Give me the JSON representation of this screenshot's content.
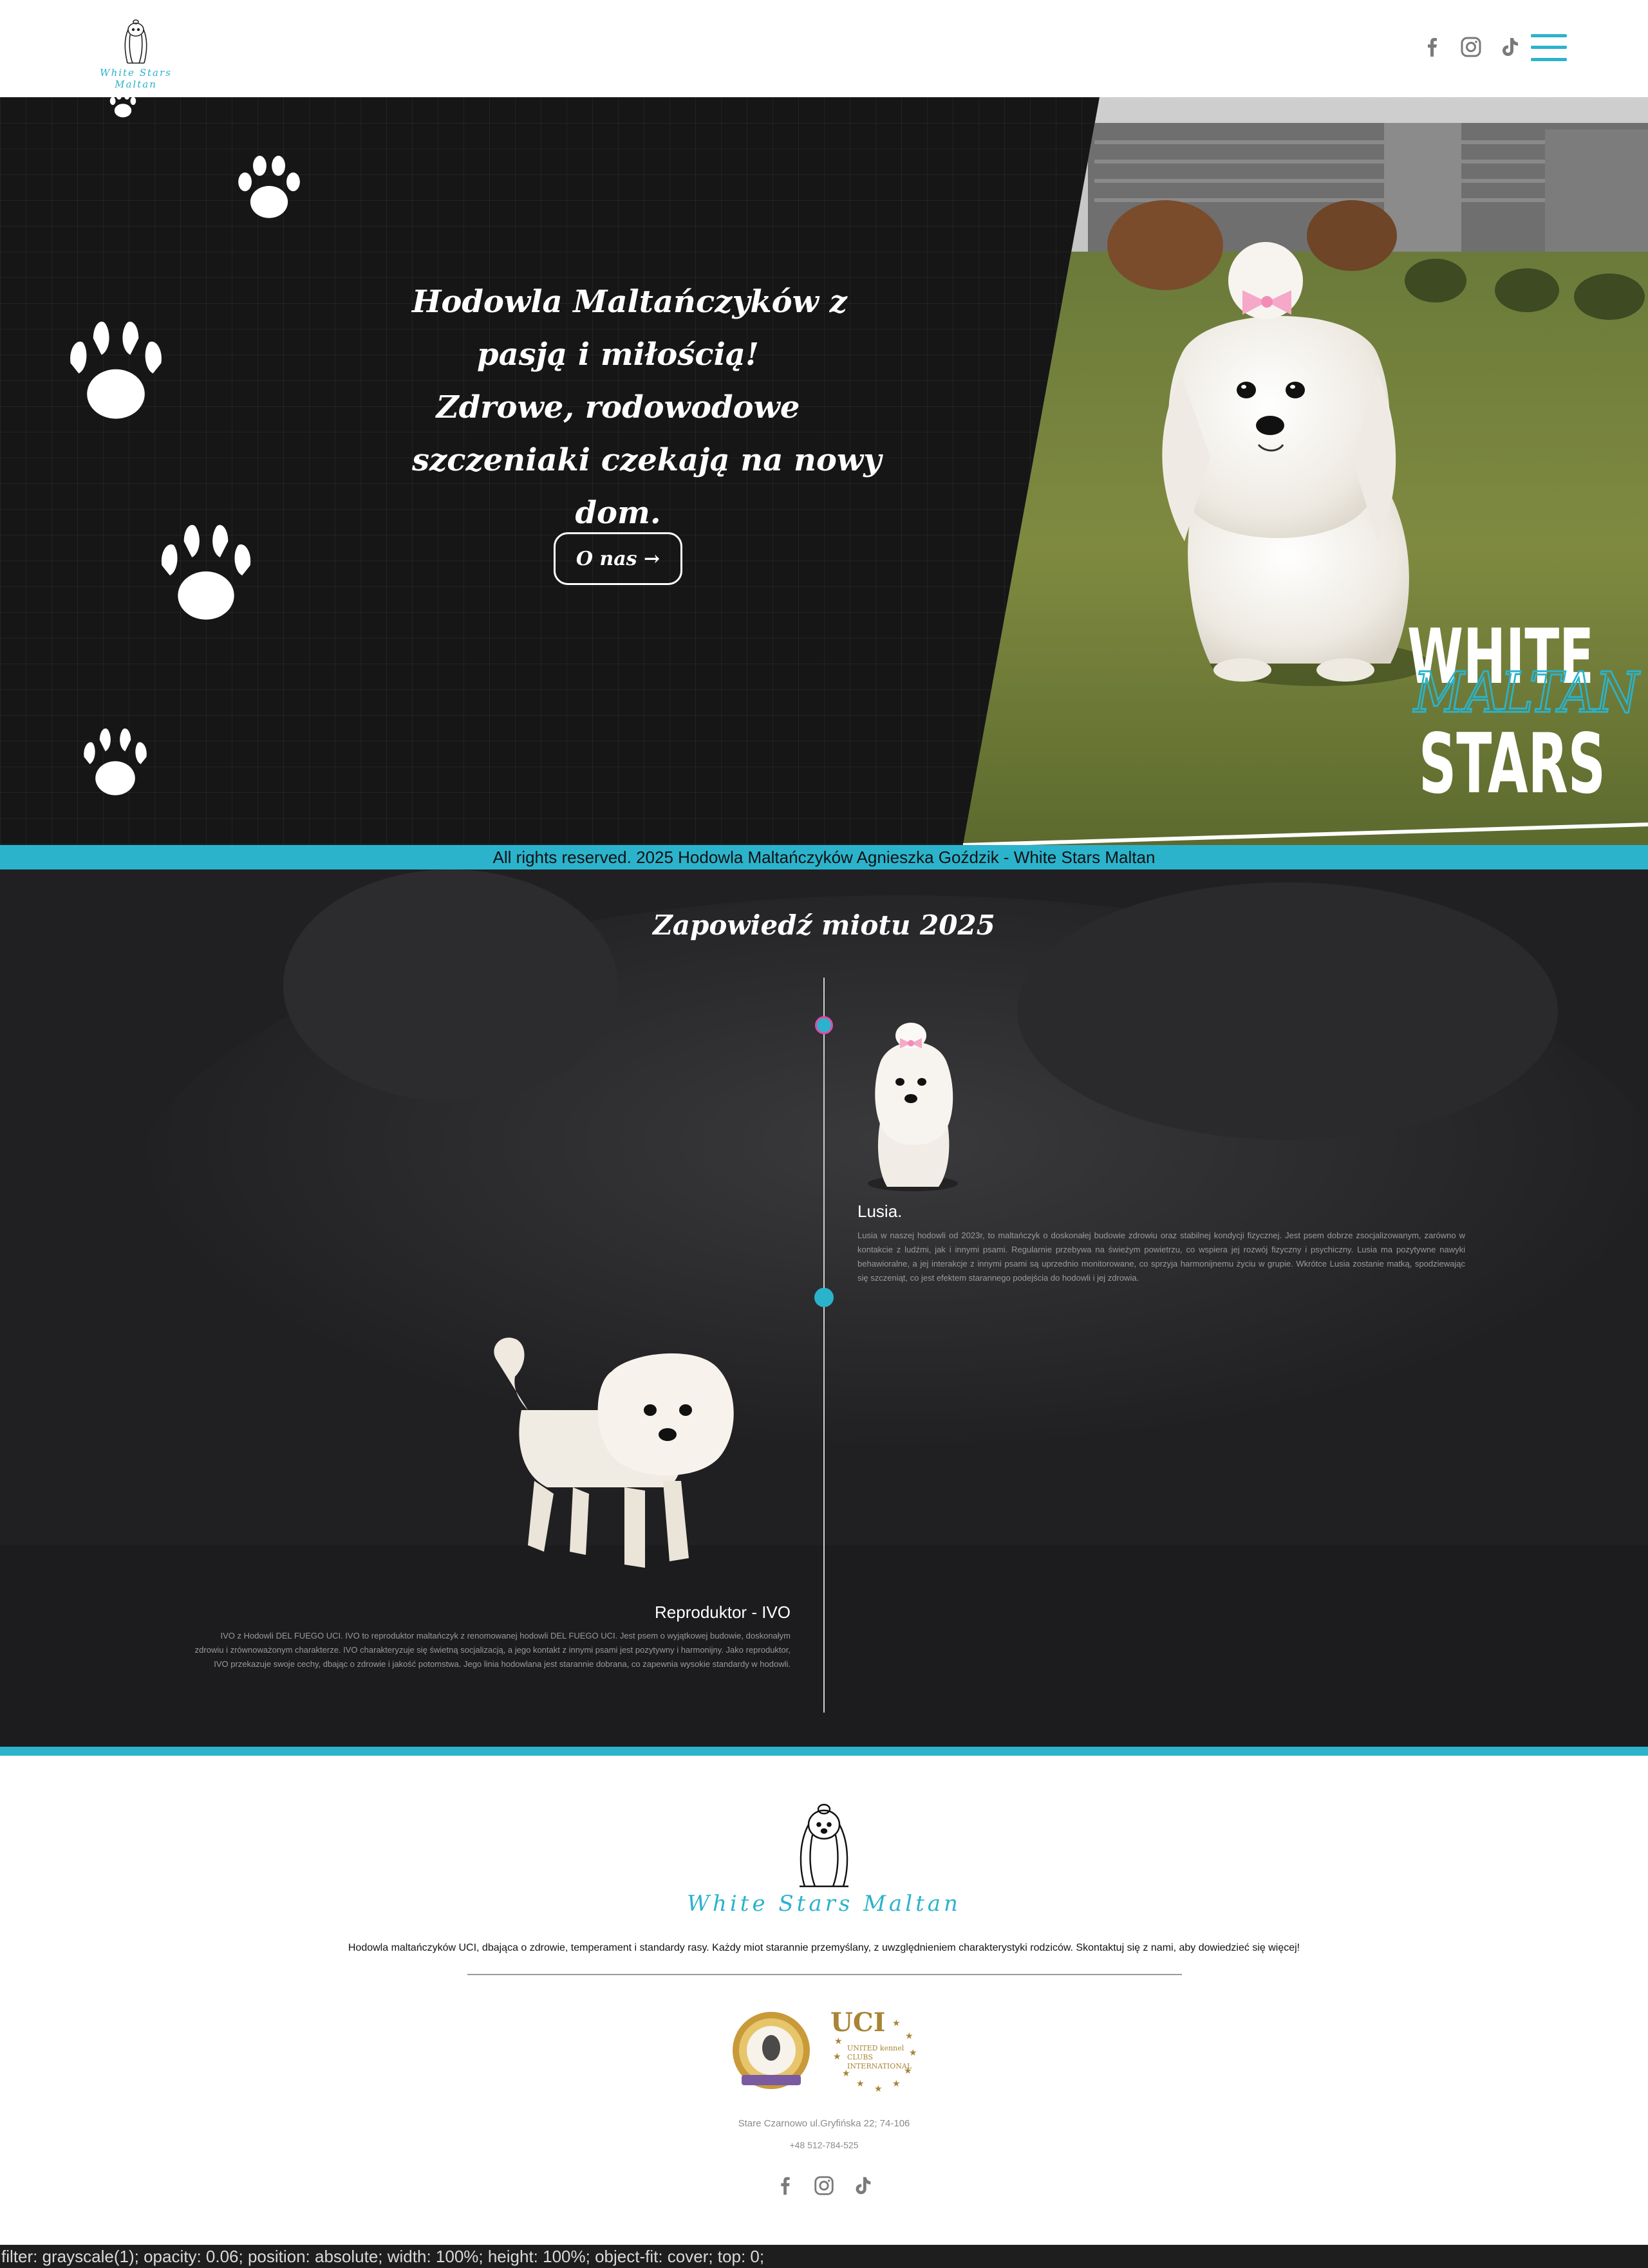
{
  "header": {
    "logo_text": "White Stars Maltan",
    "social": [
      "facebook-icon",
      "instagram-icon",
      "tiktok-icon"
    ],
    "menu_icon": "hamburger-menu-icon"
  },
  "hero": {
    "heading_lines": [
      "Hodowla Maltańczyków z",
      "pasją i miłością!",
      "Zdrowe, rodowodowe",
      "szczeniaki czekają na nowy",
      "dom."
    ],
    "button_label": "O nas →",
    "logo_line1": "WHITE",
    "logo_line2": "MALTAN",
    "logo_line3": "STARS"
  },
  "rights": "All rights reserved. 2025 Hodowla Maltańczyków Agnieszka Goździk - White Stars Maltan",
  "litter": {
    "title": "Zapowiedź miotu 2025",
    "items": [
      {
        "name": "Lusia.",
        "text": "Lusia w naszej hodowli od 2023r, to maltańczyk o doskonałej budowie zdrowiu oraz stabilnej kondycji fizycznej. Jest psem dobrze zsocjalizowanym, zarówno w kontakcie z ludźmi, jak i innymi psami. Regularnie przebywa na świeżym powietrzu, co wspiera jej rozwój fizyczny i psychiczny. Lusia ma pozytywne nawyki behawioralne, a jej interakcje z innymi psami są uprzednio monitorowane, co sprzyja harmonijnemu życiu w grupie. Wkrótce Lusia zostanie matką, spodziewając się szczeniąt, co jest efektem starannego podejścia do hodowli i jej zdrowia."
      },
      {
        "name": "Reproduktor - IVO",
        "text": "IVO z Hodowli DEL FUEGO UCI. IVO to reproduktor maltańczyk z renomowanej hodowli DEL FUEGO UCI. Jest psem o wyjątkowej budowie, doskonałym zdrowiu i zrównoważonym charakterze. IVO charakteryzuje się świetną socjalizacją, a jego kontakt z innymi psami jest pozytywny i harmonijny. Jako reproduktor, IVO przekazuje swoje cechy, dbając o zdrowie i jakość potomstwa. Jego linia hodowlana jest starannie dobrana, co zapewnia wysokie standardy w hodowli."
      }
    ]
  },
  "footer": {
    "brand": "White Stars Maltan",
    "description": "Hodowla maltańczyków UCI, dbająca o zdrowie, temperament i standardy rasy. Każdy miot starannie przemyślany, z uwzględnieniem charakterystyki rodziców. Skontaktuj się z nami, aby dowiedzieć się więcej!",
    "address": "Stare Czarnowo ul.Gryfińska 22; 74-106",
    "phone": "+48 512-784-525",
    "uci_text1": "UCI",
    "uci_text2": "UNITED kennel",
    "uci_text3": "CLUBS",
    "uci_text4": "INTERNATIONAL",
    "social": [
      "facebook-icon",
      "instagram-icon",
      "tiktok-icon"
    ]
  },
  "debug_text": "filter: grayscale(1); opacity: 0.06; position: absolute; width: 100%; height: 100%; object-fit: cover; top: 0;",
  "colors": {
    "accent": "#2bb3cc",
    "dark": "#161616",
    "section_bg": "#202022",
    "pink": "#f29bc3"
  }
}
